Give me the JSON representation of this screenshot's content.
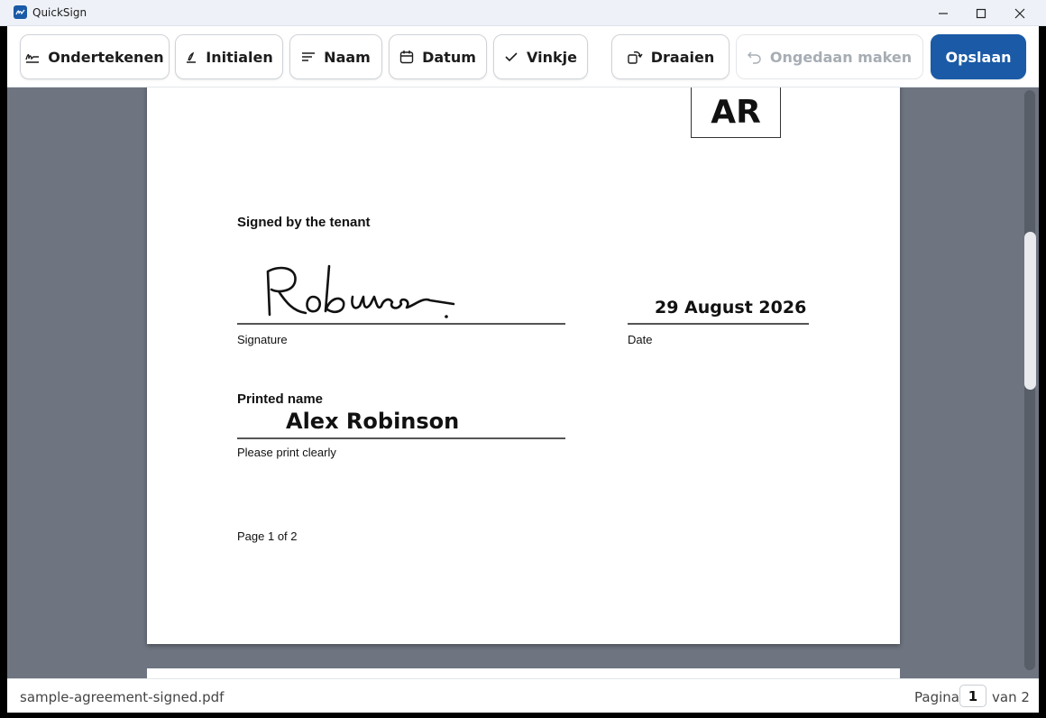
{
  "window": {
    "title": "QuickSign"
  },
  "toolbar": {
    "sign_label": "Ondertekenen",
    "initials_label": "Initialen",
    "name_label": "Naam",
    "date_label": "Datum",
    "check_label": "Vinkje",
    "rotate_label": "Draaien",
    "undo_label": "Ongedaan maken",
    "save_label": "Opslaan"
  },
  "document": {
    "initials_stamp": "AR",
    "signed_heading": "Signed by the tenant",
    "signature_caption": "Signature",
    "date_value": "29 August 2026",
    "date_caption": "Date",
    "printed_name_heading": "Printed name",
    "printed_name_value": "Alex Robinson",
    "printed_name_caption": "Please print clearly",
    "page_footer": "Page 1 of 2"
  },
  "statusbar": {
    "filename": "sample-agreement-signed.pdf",
    "page_label": "Pagina",
    "current_page": "1",
    "total_label": "van 2"
  },
  "colors": {
    "accent": "#1a5aa6",
    "viewer_background": "#6e7480"
  }
}
